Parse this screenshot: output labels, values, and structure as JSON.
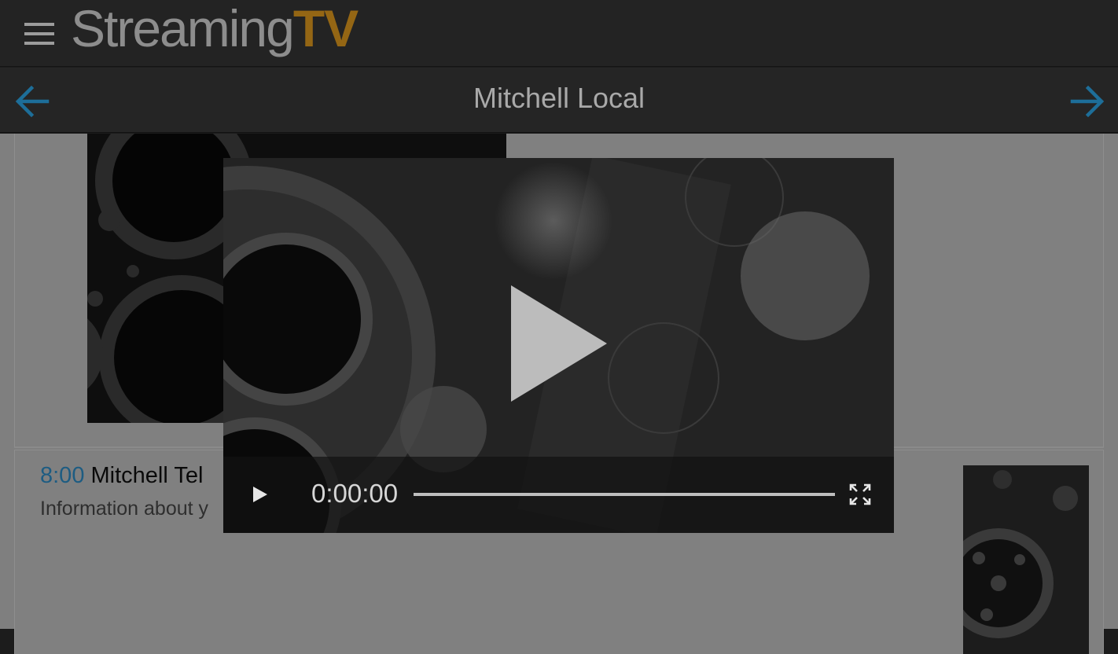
{
  "app": {
    "logo_streaming": "Streaming",
    "logo_tv": "TV",
    "menu_icon": "hamburger-menu-icon"
  },
  "channel": {
    "title": "Mitchell Local",
    "prev_icon": "arrow-left-icon",
    "next_icon": "arrow-right-icon"
  },
  "colors": {
    "accent": "#1d6e99",
    "logo_gray": "#8d8d8d",
    "logo_gold": "#946614",
    "overlay": "#7f7f7f"
  },
  "program": {
    "time": "8:00",
    "title": "Mitchell Tel",
    "description": "Information about y"
  },
  "player": {
    "time": "0:00:00",
    "progress": 1.0,
    "play_icon": "play-icon",
    "fullscreen_icon": "fullscreen-icon"
  }
}
